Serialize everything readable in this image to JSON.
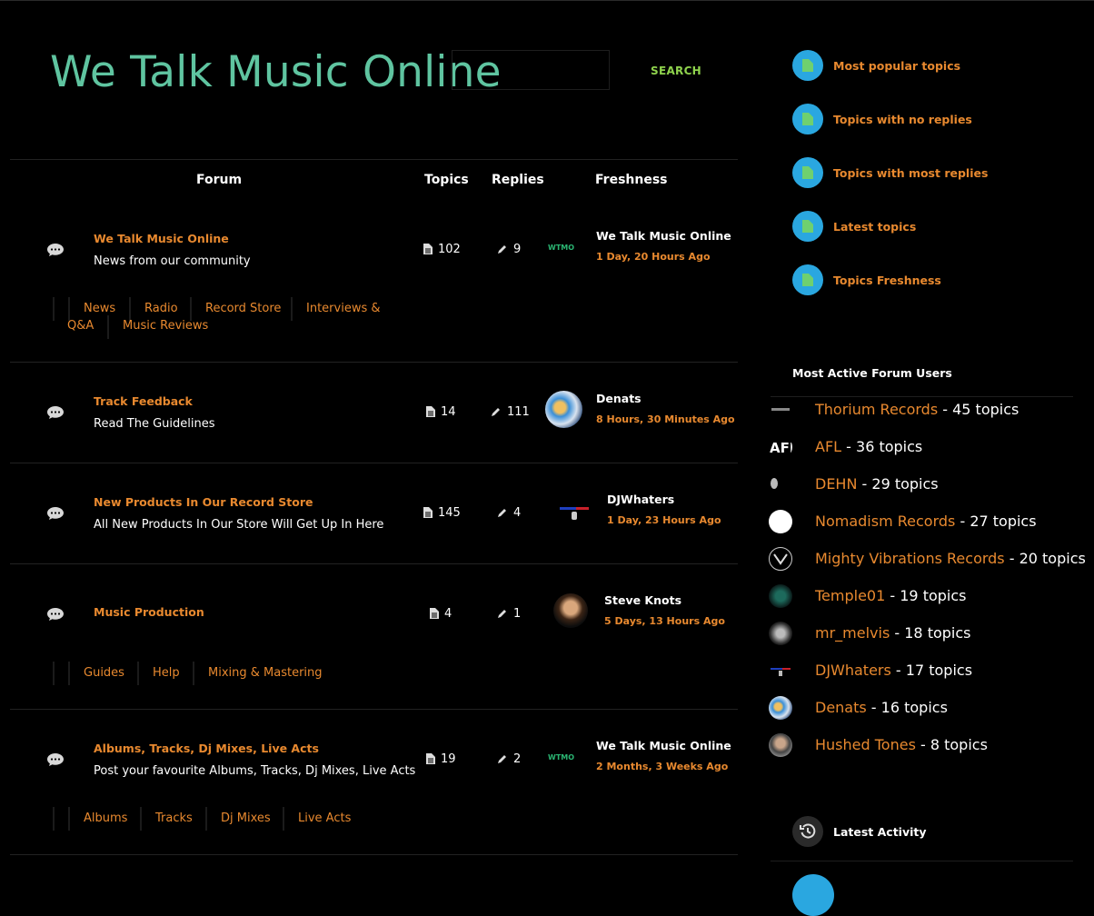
{
  "site": {
    "title": "We Talk Music Online",
    "search_label": "SEARCH",
    "search_placeholder": ""
  },
  "table": {
    "headers": {
      "forum": "Forum",
      "topics": "Topics",
      "replies": "Replies",
      "freshness": "Freshness"
    },
    "rows": [
      {
        "title": "We Talk Music Online",
        "description": "News from our community",
        "topics": "102",
        "replies": "9",
        "fresh_name": "We Talk Music Online",
        "fresh_time": "1 Day, 20 Hours Ago",
        "avatar": "wtmo-logo",
        "subforums": [
          "News",
          "Radio",
          "Record Store",
          "Interviews &",
          "Q&A",
          "Music Reviews"
        ]
      },
      {
        "title": "Track Feedback",
        "description": "Read The Guidelines",
        "topics": "14",
        "replies": "111",
        "fresh_name": "Denats",
        "fresh_time": "8 Hours, 30 Minutes Ago",
        "avatar": "denats-avatar",
        "subforums": []
      },
      {
        "title": "New Products In Our Record Store",
        "description": "All New Products In Our Store Will Get Up In Here",
        "topics": "145",
        "replies": "4",
        "fresh_name": "DJWhaters",
        "fresh_time": "1 Day, 23 Hours Ago",
        "avatar": "djwhaters-avatar",
        "subforums": []
      },
      {
        "title": "Music Production",
        "description": "",
        "topics": "4",
        "replies": "1",
        "fresh_name": "Steve Knots",
        "fresh_time": "5 Days, 13 Hours Ago",
        "avatar": "steve-knots-avatar",
        "subforums": [
          "Guides",
          "Help",
          "Mixing & Mastering"
        ]
      },
      {
        "title": "Albums, Tracks, Dj Mixes, Live Acts",
        "description": "Post your favourite Albums, Tracks, Dj Mixes, Live Acts",
        "topics": "19",
        "replies": "2",
        "fresh_name": "We Talk Music Online",
        "fresh_time": "2 Months, 3 Weeks Ago",
        "avatar": "wtmo-logo",
        "subforums": [
          "Albums",
          "Tracks",
          "Dj Mixes",
          "Live Acts"
        ]
      }
    ]
  },
  "sidebar": {
    "views": [
      "Most popular topics",
      "Topics with no replies",
      "Topics with most replies",
      "Latest topics",
      "Topics Freshness"
    ],
    "active_users_heading": "Most Active Forum Users",
    "users": [
      {
        "name": "Thorium Records",
        "count": " - 45 topics"
      },
      {
        "name": "AFL",
        "count": " - 36 topics"
      },
      {
        "name": "DEHN",
        "count": " - 29 topics"
      },
      {
        "name": "Nomadism Records",
        "count": " - 27 topics"
      },
      {
        "name": "Mighty Vibrations Records",
        "count": " - 20 topics"
      },
      {
        "name": "Temple01",
        "count": " - 19 topics"
      },
      {
        "name": "mr_melvis",
        "count": " - 18 topics"
      },
      {
        "name": "DJWhaters",
        "count": " - 17 topics"
      },
      {
        "name": "Denats",
        "count": " - 16 topics"
      },
      {
        "name": "Hushed Tones",
        "count": " - 8 topics"
      }
    ],
    "latest_activity_heading": "Latest Activity"
  },
  "colors": {
    "accent": "#e8892f",
    "title": "#5fc4a0",
    "search": "#8fd34d",
    "view_circle": "#2aa7e0"
  }
}
